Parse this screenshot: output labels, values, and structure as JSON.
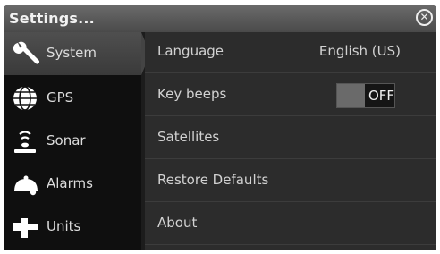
{
  "window": {
    "title": "Settings...",
    "close_icon": "close-icon"
  },
  "sidebar": {
    "items": [
      {
        "label": "System",
        "icon": "wrench-icon",
        "active": true
      },
      {
        "label": "GPS",
        "icon": "globe-icon",
        "active": false
      },
      {
        "label": "Sonar",
        "icon": "sonar-icon",
        "active": false
      },
      {
        "label": "Alarms",
        "icon": "alarm-icon",
        "active": false
      },
      {
        "label": "Units",
        "icon": "units-icon",
        "active": false
      }
    ]
  },
  "settings": {
    "rows": [
      {
        "label": "Language",
        "value": "English (US)"
      },
      {
        "label": "Key beeps",
        "toggle_state": "OFF"
      },
      {
        "label": "Satellites"
      },
      {
        "label": "Restore Defaults"
      },
      {
        "label": "About"
      }
    ]
  }
}
